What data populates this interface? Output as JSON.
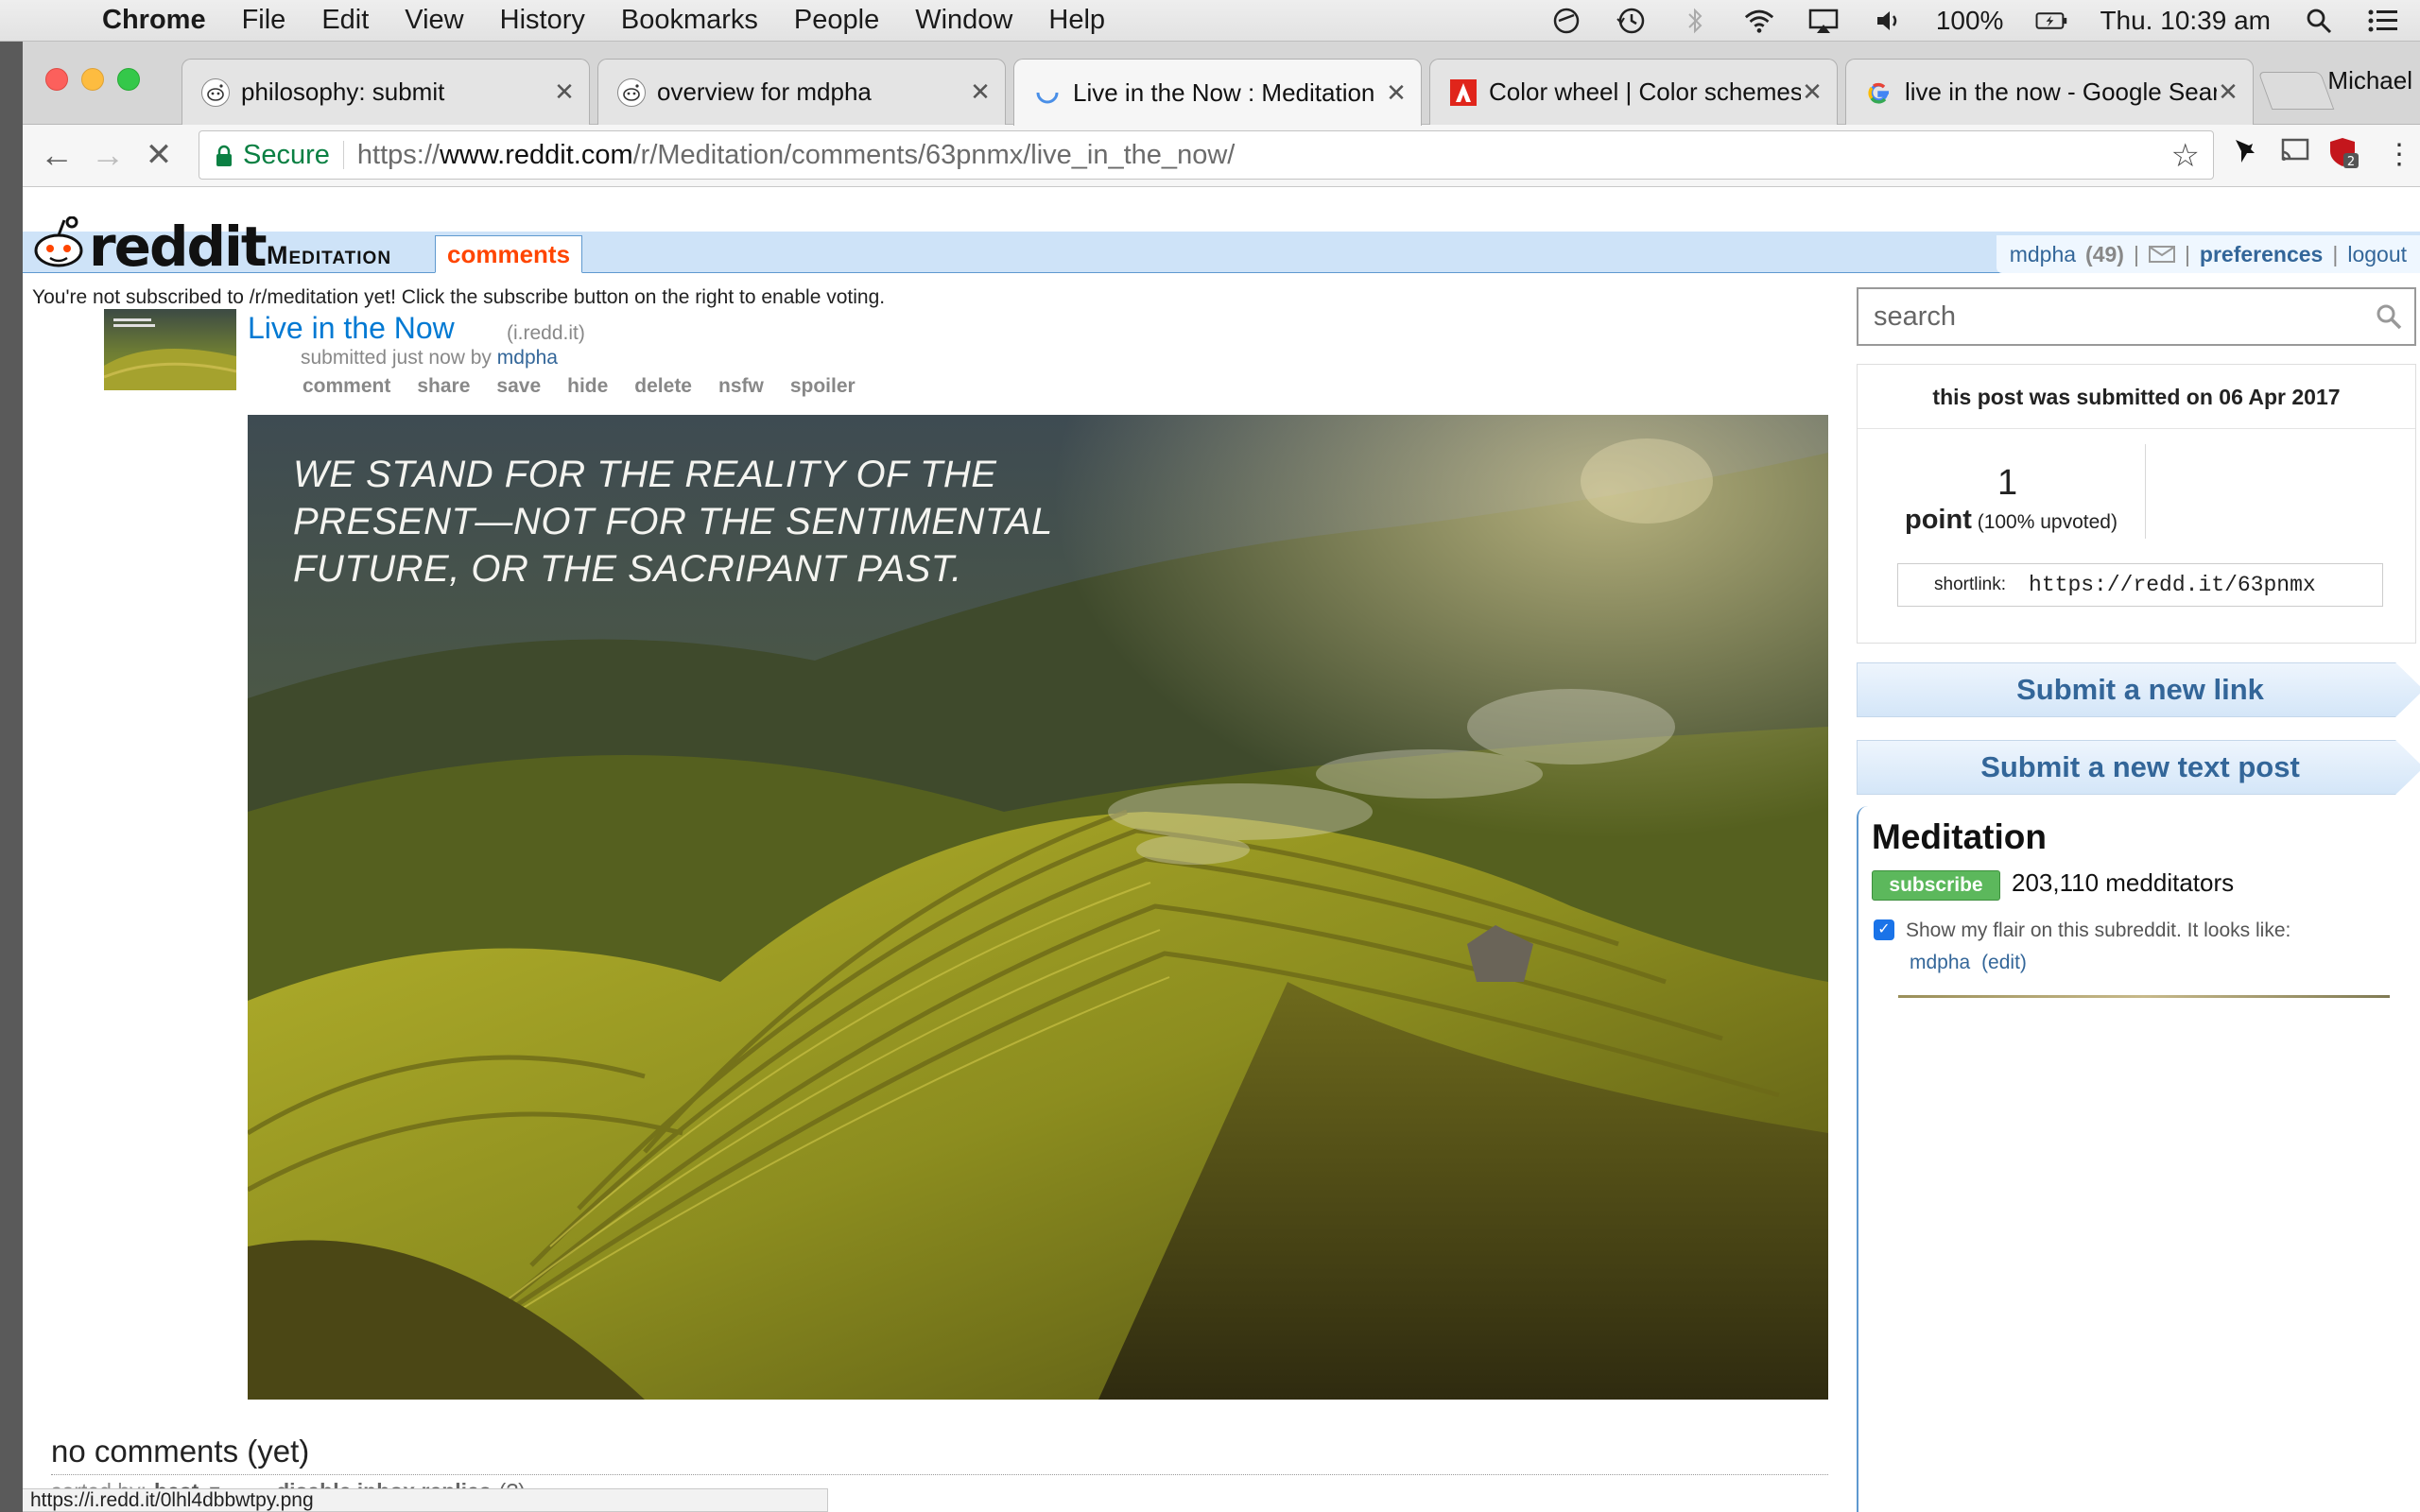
{
  "menubar": {
    "app": "Chrome",
    "items": [
      "File",
      "Edit",
      "View",
      "History",
      "Bookmarks",
      "People",
      "Window",
      "Help"
    ],
    "battery": "100%",
    "clock": "Thu. 10:39 am"
  },
  "browser": {
    "tabs": [
      {
        "title": "philosophy: submit",
        "icon": "reddit-icon"
      },
      {
        "title": "overview for mdpha",
        "icon": "reddit-icon"
      },
      {
        "title": "Live in the Now : Meditation",
        "icon": "loading-spinner-icon"
      },
      {
        "title": "Color wheel | Color schemes",
        "icon": "adobe-icon"
      },
      {
        "title": "live in the now - Google Search",
        "icon": "google-icon"
      }
    ],
    "profile": "Michael",
    "secure_label": "Secure",
    "url_scheme": "https://",
    "url_host": "www.reddit.com",
    "url_path": "/r/Meditation/comments/63pnmx/live_in_the_now/",
    "extension_badge": "2",
    "status_url": "https://i.redd.it/0lhl4dbbwtpy.png"
  },
  "header": {
    "logo_text": "reddit",
    "subreddit": "Meditation",
    "active_tab": "comments",
    "user": "mdpha",
    "karma": "(49)",
    "sep": "|",
    "preferences": "preferences",
    "logout": "logout"
  },
  "notice": "You're not subscribed to /r/meditation yet! Click the subscribe button on the right to enable voting.",
  "post": {
    "title": "Live in the Now",
    "domain": "(i.redd.it)",
    "submitted_prefix": "submitted just now by",
    "author": "mdpha",
    "buttons": [
      "comment",
      "share",
      "save",
      "hide",
      "delete",
      "nsfw",
      "spoiler"
    ],
    "image_quote": [
      "WE STAND FOR THE REALITY OF THE",
      "PRESENT—NOT FOR THE SENTIMENTAL",
      "FUTURE, OR THE SACRIPANT PAST."
    ]
  },
  "comments": {
    "empty_text": "no comments (yet)",
    "sorted_by_label": "sorted by:",
    "sort_value": "best",
    "disable_replies": "disable inbox replies",
    "help": "(?)"
  },
  "sidebar": {
    "search_placeholder": "search",
    "submitted_on": "this post was submitted on 06 Apr 2017",
    "score": "1",
    "point_label": "point",
    "upvoted": "(100% upvoted)",
    "shortlink_label": "shortlink:",
    "shortlink_value": "https://redd.it/63pnmx",
    "submit_link": "Submit a new link",
    "submit_text": "Submit a new text post",
    "subreddit_title": "Meditation",
    "subscribe": "subscribe",
    "subscribers": "203,110 medditators",
    "flair_text": "Show my flair on this subreddit. It looks like:",
    "flair_user": "mdpha",
    "flair_edit": "(edit)"
  }
}
